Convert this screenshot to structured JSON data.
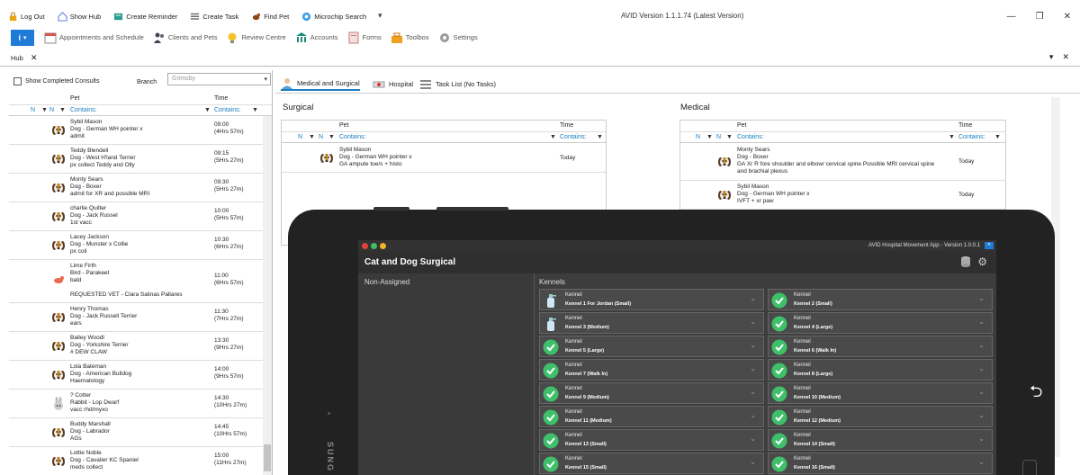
{
  "quick_access": [
    {
      "label": "Log Out",
      "icon": "lock-icon"
    },
    {
      "label": "Show Hub",
      "icon": "home-icon"
    },
    {
      "label": "Create Reminder",
      "icon": "reminder-icon"
    },
    {
      "label": "Create Task",
      "icon": "task-list-icon"
    },
    {
      "label": "Find Pet",
      "icon": "dog-icon"
    },
    {
      "label": "Microchip Search",
      "icon": "microchip-icon"
    }
  ],
  "window_title": "AVID Version 1.1.1.74 (Latest Version)",
  "ribbon": [
    {
      "label": "Appointments and Schedule",
      "icon": "calendar-icon"
    },
    {
      "label": "Clients and Pets",
      "icon": "people-icon"
    },
    {
      "label": "Review Centre",
      "icon": "lightbulb-icon"
    },
    {
      "label": "Accounts",
      "icon": "bank-icon"
    },
    {
      "label": "Forms",
      "icon": "forms-icon"
    },
    {
      "label": "Toolbox",
      "icon": "toolbox-icon"
    },
    {
      "label": "Settings",
      "icon": "gear-icon"
    }
  ],
  "app_button": "i",
  "hub_tab": "Hub",
  "left_pane": {
    "show_completed": "Show Completed Consults",
    "branch_label": "Branch",
    "branch_value": "Grimsby",
    "col_pet": "Pet",
    "col_time": "Time",
    "filter_n1": "N",
    "filter_n2": "N",
    "filter_contains": "Contains:",
    "filter_contains_time": "Contains:",
    "rows": [
      {
        "name": "Sybil Mason",
        "breed": "Dog - German WH pointer x",
        "note": "admit",
        "extra": "",
        "time": "09:00",
        "dur": "(4Hrs 57m)",
        "animal": "dog"
      },
      {
        "name": "Teddy Blendell",
        "breed": "Dog - West H'land Terrier",
        "note": "px collect Teddy and Olly",
        "extra": "",
        "time": "09:15",
        "dur": "(5Hrs 27m)",
        "animal": "dog"
      },
      {
        "name": "Monty Sears",
        "breed": "Dog - Boxer",
        "note": "admit for XR and possible MRI",
        "extra": "",
        "time": "09:30",
        "dur": "(5Hrs 27m)",
        "animal": "dog"
      },
      {
        "name": "charlie Quilter",
        "breed": "Dog - Jack Russel",
        "note": "1st vacc",
        "extra": "",
        "time": "10:00",
        "dur": "(5Hrs 57m)",
        "animal": "dog"
      },
      {
        "name": "Lacey Jackson",
        "breed": "Dog - Munster x Collie",
        "note": "px coil",
        "extra": "",
        "time": "10:30",
        "dur": "(6Hrs 27m)",
        "animal": "dog"
      },
      {
        "name": "Lime Firth",
        "breed": "Bird - Parakeet",
        "note": "bald",
        "extra": "REQUESTED VET - Clara Salinas Pallares",
        "time": "11:00",
        "dur": "(6Hrs 57m)",
        "animal": "bird"
      },
      {
        "name": "Henry Thomas",
        "breed": "Dog - Jack Russell Terrier",
        "note": "ears",
        "extra": "",
        "time": "11:30",
        "dur": "(7Hrs 27m)",
        "animal": "dog"
      },
      {
        "name": "Bailey Woodl",
        "breed": "Dog - Yorkshire Terrier",
        "note": "# DEW CLAW",
        "extra": "",
        "time": "13:30",
        "dur": "(9Hrs 27m)",
        "animal": "dog"
      },
      {
        "name": "Lola Bateman",
        "breed": "Dog - American Bulldog",
        "note": "Haematology",
        "extra": "",
        "time": "14:00",
        "dur": "(9Hrs 57m)",
        "animal": "dog"
      },
      {
        "name": "? Cotter",
        "breed": "Rabbit - Lop Dwarf",
        "note": "vacc rhd/myxo",
        "extra": "",
        "time": "14:30",
        "dur": "(10Hrs 27m)",
        "animal": "rabbit"
      },
      {
        "name": "Buddy Marshall",
        "breed": "Dog - Labrador",
        "note": "AGs",
        "extra": "",
        "time": "14:45",
        "dur": "(10Hrs 57m)",
        "animal": "dog"
      },
      {
        "name": "Lottie Noble",
        "breed": "Dog - Cavalier KC Spaniel",
        "note": "meds collect",
        "extra": "",
        "time": "15:00",
        "dur": "(11Hrs 27m)",
        "animal": "dog"
      }
    ]
  },
  "right_tabs": [
    {
      "label": "Medical and Surgical",
      "icon": "doctor-icon"
    },
    {
      "label": "Hospital",
      "icon": "ambulance-icon"
    },
    {
      "label": "Task List (No Tasks)",
      "icon": "task-list-icon"
    }
  ],
  "surgical": {
    "title": "Surgical",
    "col_pet": "Pet",
    "col_time": "Time",
    "filter_n1": "N",
    "filter_n2": "N",
    "filter_contains": "Contains:",
    "filter_contains_time": "Contains:",
    "rows": [
      {
        "name": "Sybil Mason",
        "breed": "Dog - German WH pointer x",
        "note": "GA ampute toe/s + histo",
        "time": "Today"
      }
    ]
  },
  "medical": {
    "title": "Medical",
    "col_pet": "Pet",
    "col_time": "Time",
    "filter_n1": "N",
    "filter_n2": "N",
    "filter_contains": "Contains:",
    "filter_contains_time": "Contains:",
    "rows": [
      {
        "name": "Monty Sears",
        "breed": "Dog - Boxer",
        "note": "GA Xr R fore shoulder and elbow/ cervical spine Possible MRI cervical spine",
        "note2": "and brachial plexus",
        "time": "Today"
      },
      {
        "name": "Sybil Mason",
        "breed": "Dog - German WH pointer x",
        "note": "IVFT + xr paw",
        "note2": "",
        "time": "Today"
      }
    ]
  },
  "tablet": {
    "app_title": "AVID Hospital Movement App - Version 1.0.0.1",
    "heading": "Cat and Dog Surgical",
    "non_assigned": "Non-Assigned",
    "kennels_label": "Kennels",
    "kennel_word": "Kennel",
    "brand": "SUNG",
    "kennels": [
      {
        "name": "Kennel 1 For Jordan (Small)",
        "status": "spray"
      },
      {
        "name": "Kennel 2 (Small)",
        "status": "ok"
      },
      {
        "name": "Kennel 3 (Medium)",
        "status": "spray"
      },
      {
        "name": "Kennel 4 (Large)",
        "status": "ok"
      },
      {
        "name": "Kennel 5 (Large)",
        "status": "ok"
      },
      {
        "name": "Kennel 6 (Walk In)",
        "status": "ok"
      },
      {
        "name": "Kennel 7 (Walk In)",
        "status": "ok"
      },
      {
        "name": "Kennel 8 (Large)",
        "status": "ok"
      },
      {
        "name": "Kennel 9 (Medium)",
        "status": "ok"
      },
      {
        "name": "Kennel 10 (Medium)",
        "status": "ok"
      },
      {
        "name": "Kennel 11 (Medium)",
        "status": "ok"
      },
      {
        "name": "Kennel 12 (Medium)",
        "status": "ok"
      },
      {
        "name": "Kennel 13 (Small)",
        "status": "ok"
      },
      {
        "name": "Kennel 14 (Small)",
        "status": "ok"
      },
      {
        "name": "Kennel 15 (Small)",
        "status": "ok"
      },
      {
        "name": "Kennel 16 (Small)",
        "status": "ok"
      }
    ]
  },
  "colors": {
    "accent": "#1a7fc0",
    "check_green": "#3fbf6a",
    "app_blue": "#1f7bd8"
  }
}
